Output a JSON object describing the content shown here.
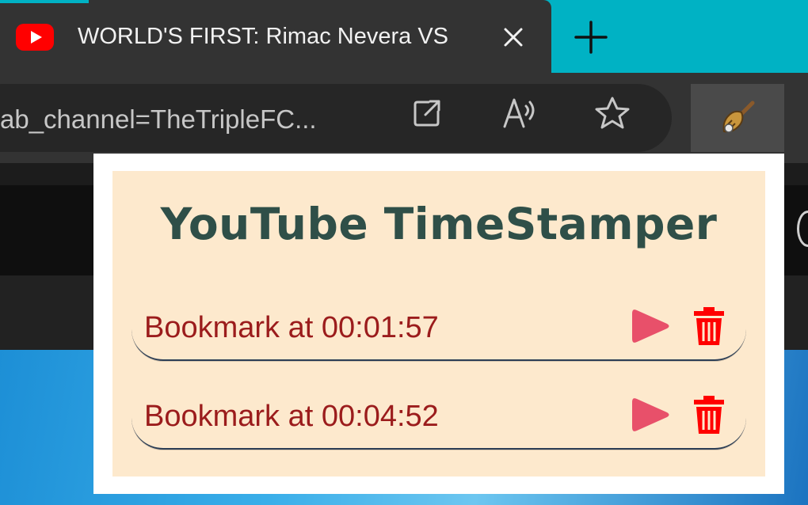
{
  "browser": {
    "tab": {
      "title": "WORLD'S FIRST: Rimac Nevera VS",
      "favicon": "youtube-icon"
    },
    "address_bar": {
      "url_text": "ab_channel=TheTripleFC..."
    },
    "toolbar_icons": [
      "open-in-app-icon",
      "read-aloud-icon",
      "favorite-star-icon",
      "extension-broom-icon"
    ]
  },
  "popup": {
    "title": "YouTube TimeStamper",
    "bookmarks": [
      {
        "label": "Bookmark at 00:01:57"
      },
      {
        "label": "Bookmark at 00:04:52"
      }
    ]
  },
  "colors": {
    "tabstrip_accent": "#00b2c4",
    "popup_background": "#fde9cd",
    "title_color": "#2f4f48",
    "bookmark_text": "#9b1c1c",
    "play_color": "#e8506a",
    "delete_color": "#ff0000"
  }
}
